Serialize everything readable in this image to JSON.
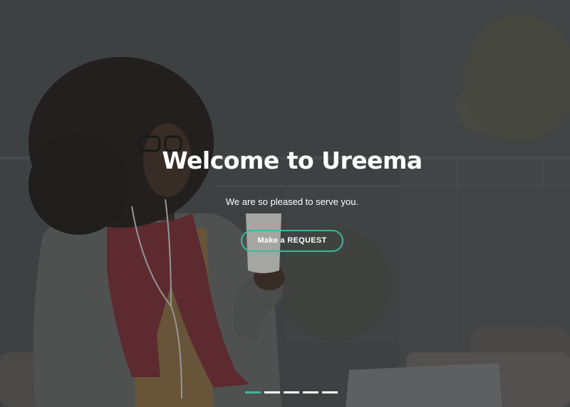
{
  "hero": {
    "title": "Welcome to Ureema",
    "subtitle": "We are so pleased to serve you.",
    "cta_label": "Make a REQUEST"
  },
  "slider": {
    "slide_count": 5,
    "active_index": 0
  },
  "colors": {
    "accent": "#3bb89a",
    "overlay": "#282a2b",
    "text": "#ffffff"
  }
}
